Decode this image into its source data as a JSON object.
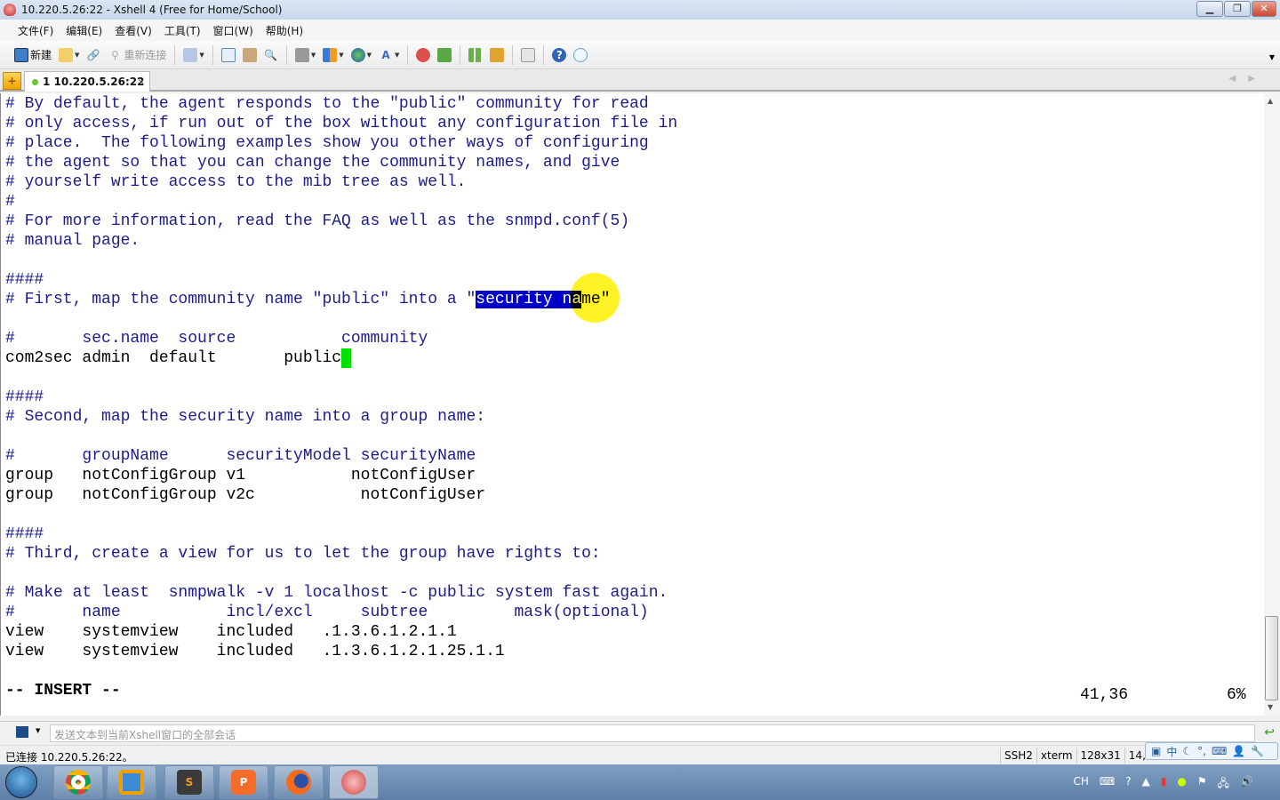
{
  "window": {
    "title": "10.220.5.26:22 - Xshell 4 (Free for Home/School)",
    "controls": [
      "minimize",
      "restore",
      "close"
    ]
  },
  "menu": [
    "文件(F)",
    "编辑(E)",
    "查看(V)",
    "工具(T)",
    "窗口(W)",
    "帮助(H)"
  ],
  "toolbar": {
    "new_label": "新建",
    "reconnect_label": "重新连接",
    "icons": [
      "new-session-icon",
      "open-folder-icon",
      "link-icon",
      "reconnect-icon",
      "properties-icon",
      "copy-icon",
      "paste-icon",
      "find-icon",
      "print-icon",
      "transfer-icon",
      "globe-icon",
      "font-icon",
      "xshell-icon",
      "xftp-icon",
      "layout-icon",
      "lock-icon",
      "keyboard-icon",
      "help-icon",
      "chat-icon"
    ]
  },
  "tab": {
    "label": "1 10.220.5.26:22",
    "close": "×",
    "status_color": "#6bc23a"
  },
  "terminal": {
    "rows": [
      {
        "t": "# By default, the agent responds to the \"public\" community for read",
        "c": true
      },
      {
        "t": "# only access, if run out of the box without any configuration file in",
        "c": true
      },
      {
        "t": "# place.  The following examples show you other ways of configuring",
        "c": true
      },
      {
        "t": "# the agent so that you can change the community names, and give",
        "c": true
      },
      {
        "t": "# yourself write access to the mib tree as well.",
        "c": true
      },
      {
        "t": "#",
        "c": true
      },
      {
        "t": "# For more information, read the FAQ as well as the snmpd.conf(5)",
        "c": true
      },
      {
        "t": "# manual page.",
        "c": true
      },
      {
        "t": "",
        "c": true
      },
      {
        "t": "####",
        "c": true
      },
      {
        "t": "# First, map the community name \"public\" into a \"",
        "c": true,
        "sel": "security na",
        "after": "me\""
      },
      {
        "t": "",
        "c": true
      },
      {
        "t": "#       sec.name  source           community",
        "c": true
      },
      {
        "t": "com2sec admin  default       public",
        "c": false,
        "cursor": true
      },
      {
        "t": "",
        "c": true
      },
      {
        "t": "####",
        "c": true
      },
      {
        "t": "# Second, map the security name into a group name:",
        "c": true
      },
      {
        "t": "",
        "c": true
      },
      {
        "t": "#       groupName      securityModel securityName",
        "c": true
      },
      {
        "t": "group   notConfigGroup v1           notConfigUser",
        "c": false
      },
      {
        "t": "group   notConfigGroup v2c           notConfigUser",
        "c": false
      },
      {
        "t": "",
        "c": true
      },
      {
        "t": "####",
        "c": true
      },
      {
        "t": "# Third, create a view for us to let the group have rights to:",
        "c": true
      },
      {
        "t": "",
        "c": true
      },
      {
        "t": "# Make at least  snmpwalk -v 1 localhost -c public system fast again.",
        "c": true
      },
      {
        "t": "#       name           incl/excl     subtree         mask(optional)",
        "c": true
      },
      {
        "t": "view    systemview    included   .1.3.6.1.2.1.1",
        "c": false
      },
      {
        "t": "view    systemview    included   .1.3.6.1.2.1.25.1.1",
        "c": false
      }
    ],
    "mode": "-- INSERT --",
    "cursor_pos": "41,36",
    "scroll_percent": "6%",
    "cursor_color": "#00e000",
    "selection_color": "#0000c8"
  },
  "sendbar": {
    "placeholder": "发送文本到当前Xshell窗口的全部会话"
  },
  "status": {
    "text": "已连接 10.220.5.26:22。",
    "protocol": "SSH2",
    "term": "xterm",
    "size": "128x31",
    "pos": "14,36"
  },
  "ime": {
    "label": "中"
  },
  "taskbar": {
    "apps": [
      "chrome",
      "vmware",
      "sublime-text",
      "wps-presentation",
      "firefox",
      "xshell"
    ],
    "tray_lang": "CH"
  }
}
